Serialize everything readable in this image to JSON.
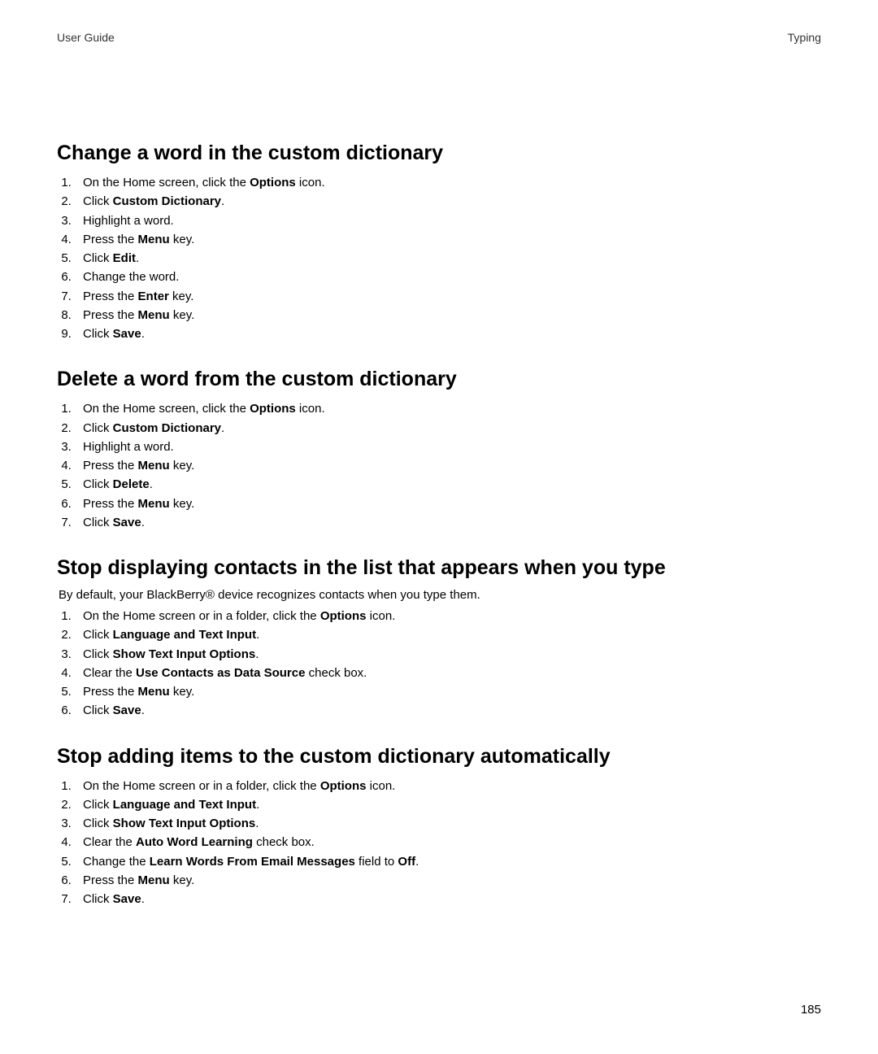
{
  "header": {
    "left": "User Guide",
    "right": "Typing"
  },
  "page_number": "185",
  "sections": [
    {
      "heading": "Change a word in the custom dictionary",
      "intro": null,
      "steps": [
        [
          {
            "t": "On the Home screen, click the "
          },
          {
            "t": "Options",
            "b": true
          },
          {
            "t": " icon."
          }
        ],
        [
          {
            "t": "Click "
          },
          {
            "t": "Custom Dictionary",
            "b": true
          },
          {
            "t": "."
          }
        ],
        [
          {
            "t": "Highlight a word."
          }
        ],
        [
          {
            "t": "Press the "
          },
          {
            "t": "Menu",
            "b": true
          },
          {
            "t": " key."
          }
        ],
        [
          {
            "t": "Click "
          },
          {
            "t": "Edit",
            "b": true
          },
          {
            "t": "."
          }
        ],
        [
          {
            "t": "Change the word."
          }
        ],
        [
          {
            "t": "Press the "
          },
          {
            "t": "Enter",
            "b": true
          },
          {
            "t": " key."
          }
        ],
        [
          {
            "t": "Press the "
          },
          {
            "t": "Menu",
            "b": true
          },
          {
            "t": " key."
          }
        ],
        [
          {
            "t": "Click "
          },
          {
            "t": "Save",
            "b": true
          },
          {
            "t": "."
          }
        ]
      ]
    },
    {
      "heading": "Delete a word from the custom dictionary",
      "intro": null,
      "steps": [
        [
          {
            "t": "On the Home screen, click the "
          },
          {
            "t": "Options",
            "b": true
          },
          {
            "t": " icon."
          }
        ],
        [
          {
            "t": "Click "
          },
          {
            "t": "Custom Dictionary",
            "b": true
          },
          {
            "t": "."
          }
        ],
        [
          {
            "t": "Highlight a word."
          }
        ],
        [
          {
            "t": "Press the "
          },
          {
            "t": "Menu",
            "b": true
          },
          {
            "t": " key."
          }
        ],
        [
          {
            "t": "Click "
          },
          {
            "t": "Delete",
            "b": true
          },
          {
            "t": "."
          }
        ],
        [
          {
            "t": "Press the "
          },
          {
            "t": "Menu",
            "b": true
          },
          {
            "t": " key."
          }
        ],
        [
          {
            "t": "Click "
          },
          {
            "t": "Save",
            "b": true
          },
          {
            "t": "."
          }
        ]
      ]
    },
    {
      "heading": "Stop displaying contacts in the list that appears when you type",
      "intro": "By default, your BlackBerry® device recognizes contacts when you type them.",
      "steps": [
        [
          {
            "t": "On the Home screen or in a folder, click the "
          },
          {
            "t": "Options",
            "b": true
          },
          {
            "t": " icon."
          }
        ],
        [
          {
            "t": "Click "
          },
          {
            "t": "Language and Text Input",
            "b": true
          },
          {
            "t": "."
          }
        ],
        [
          {
            "t": "Click "
          },
          {
            "t": "Show Text Input Options",
            "b": true
          },
          {
            "t": "."
          }
        ],
        [
          {
            "t": "Clear the "
          },
          {
            "t": "Use Contacts as Data Source",
            "b": true
          },
          {
            "t": " check box."
          }
        ],
        [
          {
            "t": "Press the "
          },
          {
            "t": "Menu",
            "b": true
          },
          {
            "t": " key."
          }
        ],
        [
          {
            "t": "Click "
          },
          {
            "t": "Save",
            "b": true
          },
          {
            "t": "."
          }
        ]
      ]
    },
    {
      "heading": "Stop adding items to the custom dictionary automatically",
      "intro": null,
      "steps": [
        [
          {
            "t": "On the Home screen or in a folder, click the "
          },
          {
            "t": "Options",
            "b": true
          },
          {
            "t": " icon."
          }
        ],
        [
          {
            "t": "Click "
          },
          {
            "t": "Language and Text Input",
            "b": true
          },
          {
            "t": "."
          }
        ],
        [
          {
            "t": "Click "
          },
          {
            "t": "Show Text Input Options",
            "b": true
          },
          {
            "t": "."
          }
        ],
        [
          {
            "t": "Clear the "
          },
          {
            "t": "Auto Word Learning",
            "b": true
          },
          {
            "t": " check box."
          }
        ],
        [
          {
            "t": "Change the "
          },
          {
            "t": "Learn Words From Email Messages",
            "b": true
          },
          {
            "t": " field to "
          },
          {
            "t": "Off",
            "b": true
          },
          {
            "t": "."
          }
        ],
        [
          {
            "t": "Press the "
          },
          {
            "t": "Menu",
            "b": true
          },
          {
            "t": " key."
          }
        ],
        [
          {
            "t": "Click "
          },
          {
            "t": "Save",
            "b": true
          },
          {
            "t": "."
          }
        ]
      ]
    }
  ]
}
